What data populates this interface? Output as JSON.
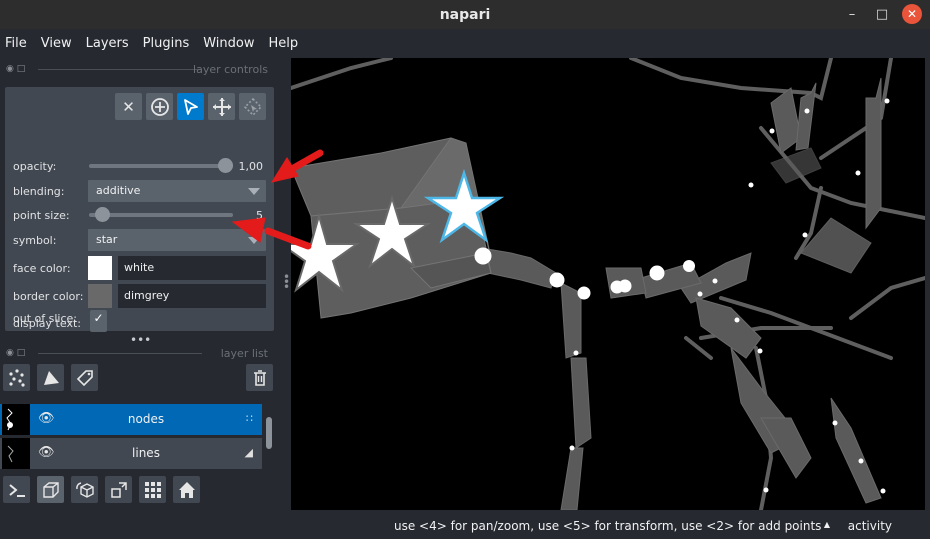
{
  "window": {
    "title": "napari"
  },
  "menubar": {
    "items": [
      "File",
      "View",
      "Layers",
      "Plugins",
      "Window",
      "Help"
    ]
  },
  "panels": {
    "controls_title": "layer controls",
    "list_title": "layer list"
  },
  "controls": {
    "opacity_label": "opacity:",
    "opacity_value": "1,00",
    "opacity_level": 1.0,
    "blending_label": "blending:",
    "blending_value": "additive",
    "point_size_label": "point size:",
    "point_size_value": "5",
    "point_size_level": 0.05,
    "symbol_label": "symbol:",
    "symbol_value": "star",
    "face_color_label": "face color:",
    "face_color_value": "white",
    "face_color_hex": "#ffffff",
    "border_color_label": "border color:",
    "border_color_value": "dimgrey",
    "border_color_hex": "#696969",
    "display_text_label": "display text:",
    "display_text_checked": true,
    "out_of_slice_label": "out of slice:",
    "out_of_slice_checked": true,
    "tools": [
      "close-icon",
      "add-point-icon",
      "select-arrow-icon",
      "pan-zoom-icon",
      "transform-icon"
    ]
  },
  "layers": [
    {
      "name": "nodes",
      "type_icon": "points-icon",
      "selected": true
    },
    {
      "name": "lines",
      "type_icon": "shapes-icon",
      "selected": false
    }
  ],
  "layer_buttons": [
    "new-points-icon",
    "new-shapes-icon",
    "new-labels-icon",
    "delete-icon"
  ],
  "bottom_buttons": [
    "console-icon",
    "ndisplay-icon",
    "roll-icon",
    "transpose-icon",
    "grid-icon",
    "home-icon"
  ],
  "status": {
    "text": "use <4> for pan/zoom, use <5> for transform, use <2> for add points",
    "activity": "activity"
  },
  "colors": {
    "accent": "#007acc",
    "selected_layer": "#0068b5",
    "annotation_arrow": "#e31b1b"
  }
}
